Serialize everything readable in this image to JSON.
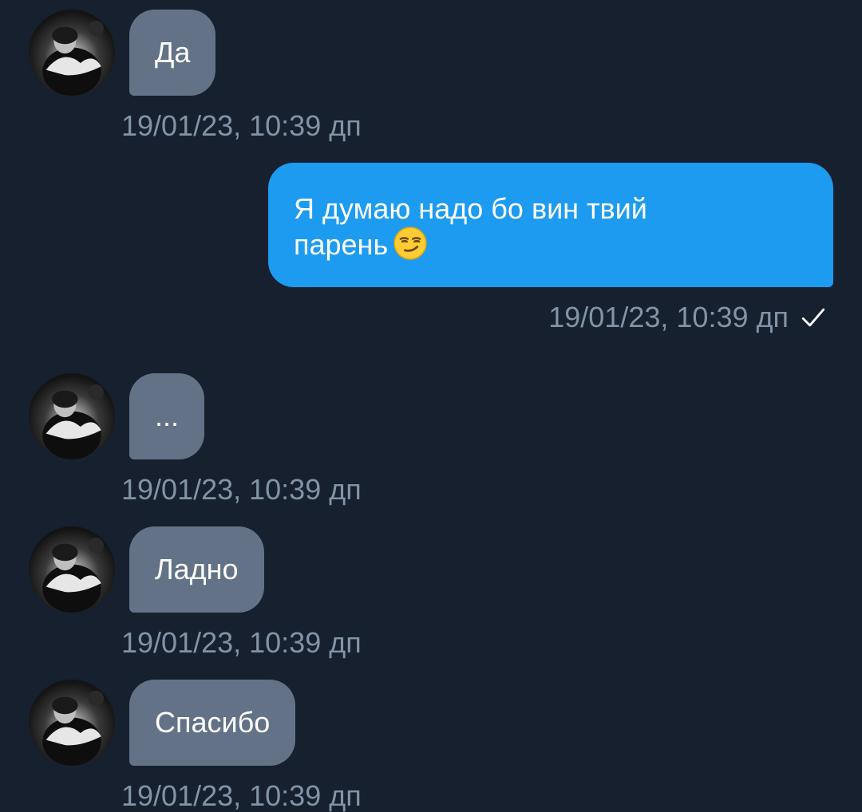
{
  "colors": {
    "background": "#16202f",
    "incoming_bubble": "#637286",
    "outgoing_bubble": "#1d9bf0",
    "timestamp": "#8293a6"
  },
  "messages": [
    {
      "direction": "incoming",
      "text": "Да",
      "timestamp": "19/01/23, 10:39 дп"
    },
    {
      "direction": "outgoing",
      "line1": "Я думаю надо бо вин твий",
      "line2": "парень",
      "emoji": "smirking-face",
      "timestamp": "19/01/23, 10:39 дп",
      "status": "sent-check"
    },
    {
      "direction": "incoming",
      "text": "...",
      "timestamp": "19/01/23, 10:39 дп"
    },
    {
      "direction": "incoming",
      "text": "Ладно",
      "timestamp": "19/01/23, 10:39 дп"
    },
    {
      "direction": "incoming",
      "text": "Спасибо",
      "timestamp": "19/01/23, 10:39 дп"
    }
  ]
}
